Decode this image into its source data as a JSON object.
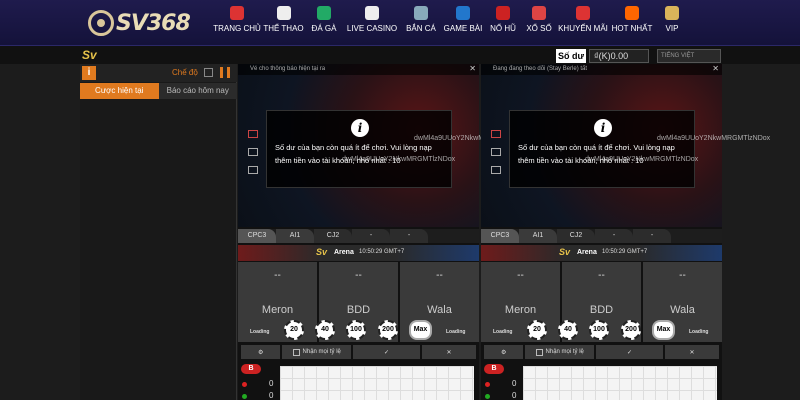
{
  "brand": {
    "name": "SV368"
  },
  "menu": [
    {
      "label": "TRANG CHỦ",
      "icon": "gift-box-icon",
      "color": "#d33"
    },
    {
      "label": "THỂ THAO",
      "icon": "soccer-ball-icon",
      "color": "#eee"
    },
    {
      "label": "ĐÁ GÀ",
      "icon": "rooster-icon",
      "color": "#2a6"
    },
    {
      "label": "LIVE CASINO",
      "icon": "playing-cards-icon",
      "color": "#eee"
    },
    {
      "label": "BẮN CÁ",
      "icon": "fish-icon",
      "color": "#8ab"
    },
    {
      "label": "GAME BÀI",
      "icon": "dice-icon",
      "color": "#27c"
    },
    {
      "label": "NỔ HŨ",
      "icon": "slot-jar-icon",
      "color": "#c22"
    },
    {
      "label": "XỔ SỐ",
      "icon": "lottery-ball-icon",
      "color": "#d44"
    },
    {
      "label": "KHUYẾN MÃI",
      "icon": "gift-icon",
      "color": "#d33"
    },
    {
      "label": "HOT NHẤT",
      "icon": "fire-icon",
      "color": "#f60"
    },
    {
      "label": "VIP",
      "icon": "diamond-icon",
      "color": "#d9b35a"
    }
  ],
  "subheader": {
    "logo": "Sv",
    "balance_button": "Số dư",
    "balance": "₫(K)0.00",
    "language": "TIẾNG VIỆT"
  },
  "left_panel": {
    "mode_label": "Chế độ",
    "tabs": [
      "Cược hiện tại",
      "Báo cáo hôm nay"
    ]
  },
  "tiles": [
    {
      "video_title": "Vé cho thông báo hiện tại ra",
      "message": "Số dư của bạn còn quá ít để chơi. Vui lòng nạp thêm tiền vào tài khoản, nhỏ nhất : 10",
      "watermark_1": "dwMl4a9UUoY2NkwMRGMTlzNDox",
      "watermark_2": "dwMl4a9UUoY2NkwMRGMTlzNDox",
      "channels": [
        "CPC3",
        "AI1",
        "CJ2",
        "-",
        "-"
      ],
      "arena": "Arena",
      "time": "10:50:29 GMT+7",
      "bets": [
        {
          "odds": "--",
          "name": "Meron"
        },
        {
          "odds": "--",
          "name": "BDD"
        },
        {
          "odds": "--",
          "name": "Wala"
        }
      ],
      "loading": "Loading",
      "chips": [
        "20",
        "40",
        "100",
        "200",
        "Max"
      ],
      "clear_label": "Nhận mọi tỷ lệ",
      "red_badge": "B",
      "count_red": "0",
      "count_green": "0"
    },
    {
      "video_title": "Đang đang theo dõi (Stay Berle) tất",
      "message": "Số dư của bạn còn quá ít để chơi. Vui lòng nạp thêm tiền vào tài khoản, nhỏ nhất : 10",
      "watermark_1": "dwMl4a9UUoY2NkwMRGMTlzNDox",
      "watermark_2": "dwMl4a9UUoY2NkwMRGMTlzNDox",
      "channels": [
        "CPC3",
        "AI1",
        "CJ2",
        "-",
        "-"
      ],
      "arena": "Arena",
      "time": "10:50:29 GMT+7",
      "bets": [
        {
          "odds": "--",
          "name": "Meron"
        },
        {
          "odds": "--",
          "name": "BDD"
        },
        {
          "odds": "--",
          "name": "Wala"
        }
      ],
      "loading": "Loading",
      "chips": [
        "20",
        "40",
        "100",
        "200",
        "Max"
      ],
      "clear_label": "Nhận mọi tỷ lệ",
      "red_badge": "B",
      "count_red": "0",
      "count_green": "0"
    }
  ]
}
